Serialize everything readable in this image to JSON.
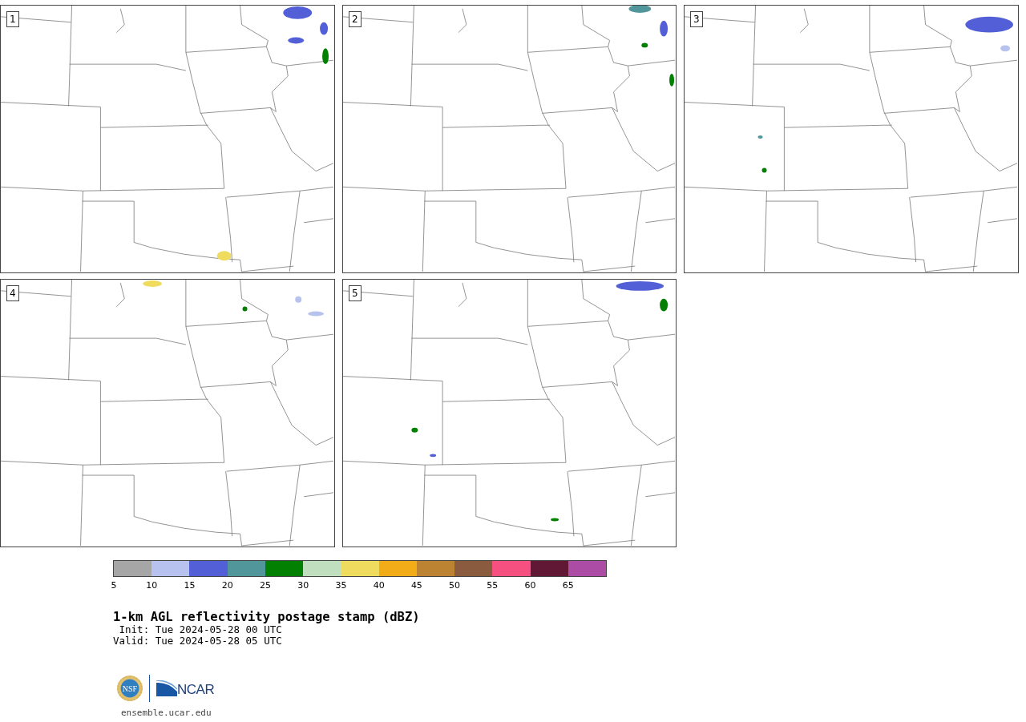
{
  "panels": [
    {
      "label": "1"
    },
    {
      "label": "2"
    },
    {
      "label": "3"
    },
    {
      "label": "4"
    },
    {
      "label": "5"
    }
  ],
  "colorbar": {
    "segments": [
      {
        "color": "#a6a6a6"
      },
      {
        "color": "#b7c3ee"
      },
      {
        "color": "#525fd6"
      },
      {
        "color": "#50969b"
      },
      {
        "color": "#018001"
      },
      {
        "color": "#bfdfbf"
      },
      {
        "color": "#efdb5e"
      },
      {
        "color": "#f1ac17"
      },
      {
        "color": "#bc8333"
      },
      {
        "color": "#8b5b3f"
      },
      {
        "color": "#f5507f"
      },
      {
        "color": "#611834"
      },
      {
        "color": "#ad4ca5"
      }
    ],
    "ticks": [
      "5",
      "10",
      "15",
      "20",
      "25",
      "30",
      "35",
      "40",
      "45",
      "50",
      "55",
      "60",
      "65"
    ]
  },
  "title": "1-km AGL reflectivity postage stamp (dBZ)",
  "init": " Init: Tue 2024-05-28 00 UTC",
  "valid": "Valid: Tue 2024-05-28 05 UTC",
  "logos": {
    "nsf": "NSF",
    "ncar": "NCAR"
  },
  "footer": "ensemble.ucar.edu"
}
